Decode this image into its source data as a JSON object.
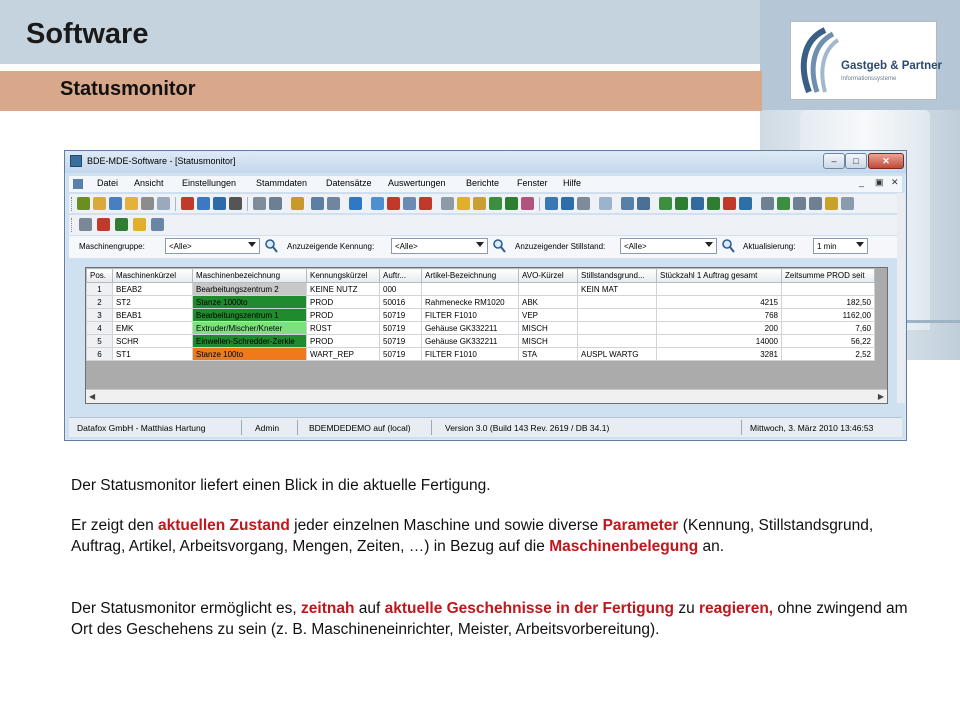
{
  "slide": {
    "title": "Software",
    "subtitle": "Statusmonitor",
    "logo": {
      "name": "Gastgeb & Partner",
      "tagline": "Informationssysteme"
    }
  },
  "window": {
    "title": "BDE-MDE-Software - [Statusmonitor]",
    "controls": {
      "minimize": "–",
      "maximize": "□",
      "close": "✕"
    },
    "mdi_controls": {
      "minimize": "_",
      "restore": "▣",
      "close": "✕"
    },
    "menu": [
      "Datei",
      "Ansicht",
      "Einstellungen",
      "Stammdaten",
      "Datensätze",
      "Auswertungen",
      "Berichte",
      "Fenster",
      "Hilfe"
    ],
    "filters": {
      "maschinengruppe_label": "Maschinengruppe:",
      "maschinengruppe_value": "<Alle>",
      "kennung_label": "Anzuzeigende Kennung:",
      "kennung_value": "<Alle>",
      "stillstand_label": "Anzuzeigender Stillstand:",
      "stillstand_value": "<Alle>",
      "aktualisierung_label": "Aktualisierung:",
      "aktualisierung_value": "1 min"
    },
    "grid": {
      "columns": [
        "Pos.",
        "Maschinenkürzel",
        "Maschinenbezeichnung",
        "Kennungskürzel",
        "Auftr...",
        "Artikel-Bezeichnung",
        "AVO-Kürzel",
        "Stillstandsgrund...",
        "Stückzahl 1 Auftrag gesamt",
        "Zeitsumme PROD seit"
      ],
      "rows": [
        {
          "pos": "1",
          "kuerzel": "BEAB2",
          "bezeichnung": "Bearbeitungszentrum 2",
          "kennung": "KEINE NUTZ",
          "auftrag": "000",
          "artikel": "",
          "avo": "",
          "stillstand": "KEIN MAT",
          "stueck": "",
          "zeit": "",
          "color": "#c8c8c8"
        },
        {
          "pos": "2",
          "kuerzel": "ST2",
          "bezeichnung": "Stanze 1000to",
          "kennung": "PROD",
          "auftrag": "50016",
          "artikel": "Rahmenecke RM1020",
          "avo": "ABK",
          "stillstand": "",
          "stueck": "4215",
          "zeit": "182,50",
          "color": "#1f8a2e"
        },
        {
          "pos": "3",
          "kuerzel": "BEAB1",
          "bezeichnung": "Bearbeitungszentrum 1",
          "kennung": "PROD",
          "auftrag": "50719",
          "artikel": "FILTER F1010",
          "avo": "VEP",
          "stillstand": "",
          "stueck": "768",
          "zeit": "1162,00",
          "color": "#1f8a2e"
        },
        {
          "pos": "4",
          "kuerzel": "EMK",
          "bezeichnung": "Extruder/Mischer/Kneter",
          "kennung": "RÜST",
          "auftrag": "50719",
          "artikel": "Gehäuse GK332211",
          "avo": "MISCH",
          "stillstand": "",
          "stueck": "200",
          "zeit": "7,60",
          "color": "#7fe07f"
        },
        {
          "pos": "5",
          "kuerzel": "SCHR",
          "bezeichnung": "Einwellen-Schredder-Zerkle",
          "kennung": "PROD",
          "auftrag": "50719",
          "artikel": "Gehäuse GK332211",
          "avo": "MISCH",
          "stillstand": "",
          "stueck": "14000",
          "zeit": "56,22",
          "color": "#1f8a2e"
        },
        {
          "pos": "6",
          "kuerzel": "ST1",
          "bezeichnung": "Stanze 100to",
          "kennung": "WART_REP",
          "auftrag": "50719",
          "artikel": "FILTER F1010",
          "avo": "STA",
          "stillstand": "AUSPL WARTG",
          "stueck": "3281",
          "zeit": "2,52",
          "color": "#f07a1a"
        }
      ]
    },
    "statusbar": {
      "company": "Datafox GmbH - Matthias Hartung",
      "user": "Admin",
      "database": "BDEMDEDEMO auf (local)",
      "version": "Version 3.0 (Build 143 Rev. 2619 / DB 34.1)",
      "datetime": "Mittwoch, 3. März 2010   13:46:53"
    }
  },
  "body": {
    "p1": "Der Statusmonitor liefert einen Blick in die aktuelle Fertigung.",
    "p2": [
      {
        "t": "Er zeigt den ",
        "hl": false
      },
      {
        "t": "aktuellen Zustand",
        "hl": true
      },
      {
        "t": " jeder einzelnen Maschine und sowie diverse ",
        "hl": false
      },
      {
        "t": "Parameter",
        "hl": true
      },
      {
        "t": " (Kennung, Stillstandsgrund, Auftrag, Artikel, Arbeitsvorgang, Mengen, Zeiten, …) in Bezug auf die ",
        "hl": false
      },
      {
        "t": "Maschinenbelegung",
        "hl": true
      },
      {
        "t": " an.",
        "hl": false
      }
    ],
    "p3": [
      {
        "t": "Der Statusmonitor ermöglicht es, ",
        "hl": false
      },
      {
        "t": "zeitnah",
        "hl": true
      },
      {
        "t": " auf ",
        "hl": false
      },
      {
        "t": "aktuelle Geschehnisse in der Fertigung",
        "hl": true
      },
      {
        "t": " zu ",
        "hl": false
      },
      {
        "t": "reagieren,",
        "hl": true
      },
      {
        "t": " ohne zwingend am Ort des Geschehens zu sein (z. B. Maschineneinrichter, Meister, Arbeitsvorbereitung).",
        "hl": false
      }
    ]
  },
  "colors": {
    "highlight": "#c0161c",
    "title_band": "#c5d3df",
    "subtitle_band": "#d9a88a"
  }
}
